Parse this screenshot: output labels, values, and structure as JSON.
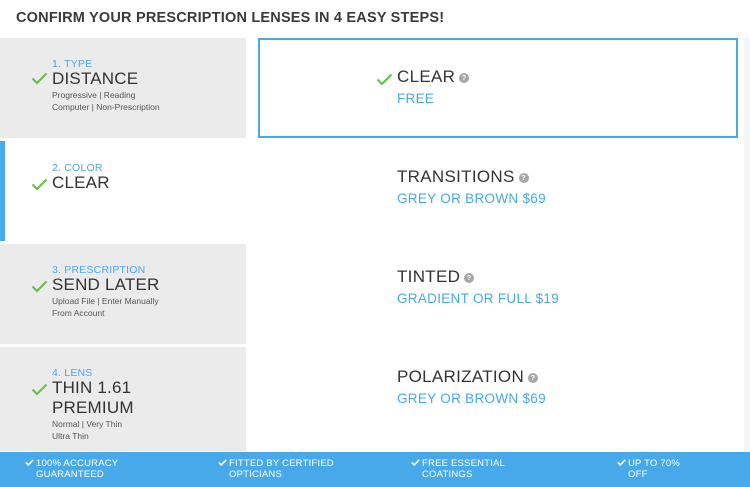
{
  "header": {
    "title": "CONFIRM YOUR PRESCRIPTION LENSES IN 4 EASY STEPS!"
  },
  "steps": [
    {
      "number": "1. TYPE",
      "value": "DISTANCE",
      "sub": [
        "Progressive  |  Reading",
        "Computer  |  Non-Prescription"
      ],
      "active": false
    },
    {
      "number": "2. COLOR",
      "value": "CLEAR",
      "sub": [],
      "active": true
    },
    {
      "number": "3. PRESCRIPTION",
      "value": "SEND LATER",
      "sub": [
        "Upload File  |  Enter Manually",
        "From Account"
      ],
      "active": false
    },
    {
      "number": "4. LENS",
      "value_lines": [
        "THIN 1.61",
        "PREMIUM"
      ],
      "sub": [
        "Normal  |  Very Thin",
        "Ultra Thin"
      ],
      "active": false
    }
  ],
  "options": [
    {
      "name": "CLEAR",
      "price": "FREE",
      "selected": true
    },
    {
      "name": "TRANSITIONS",
      "price": "GREY OR BROWN $69",
      "selected": false
    },
    {
      "name": "TINTED",
      "price": "GRADIENT OR FULL $19",
      "selected": false
    },
    {
      "name": "POLARIZATION",
      "price": "GREY OR BROWN $69",
      "selected": false
    }
  ],
  "help_glyph": "?",
  "footer": [
    {
      "lines": [
        "100% ACCURACY",
        "GUARANTEED"
      ]
    },
    {
      "lines": [
        "FITTED BY CERTIFIED",
        "OPTICIANS"
      ]
    },
    {
      "lines": [
        "FREE ESSENTIAL",
        "COATINGS"
      ]
    },
    {
      "lines": [
        "UP TO 70%",
        "OFF"
      ]
    }
  ],
  "colors": {
    "accent": "#47a9ea",
    "check": "#6cc04a",
    "step_bg": "#ebebeb",
    "text": "#333333"
  }
}
